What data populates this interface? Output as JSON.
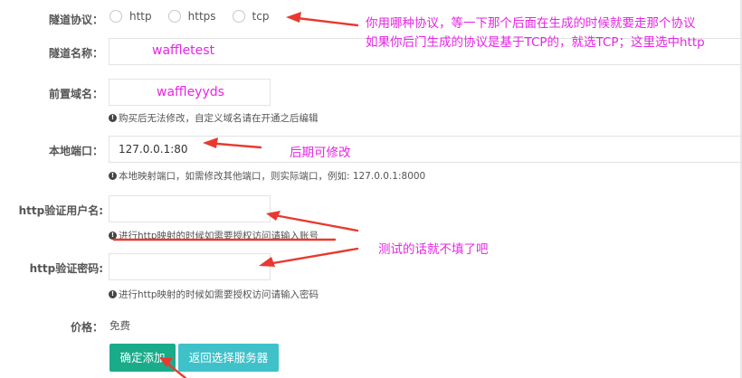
{
  "form": {
    "protocol": {
      "label": "隧道协议：",
      "options": [
        "http",
        "https",
        "tcp"
      ]
    },
    "tunnel_name": {
      "label": "隧道名称："
    },
    "prefix_domain": {
      "label": "前置域名：",
      "hint": "购买后无法修改，自定义域名请在开通之后编辑"
    },
    "local_port": {
      "label": "本地端口：",
      "value": "127.0.0.1:80",
      "hint": "本地映射端口，如需修改其他端口，则实际端口，例如:  127.0.0.1:8000"
    },
    "http_user": {
      "label": "http验证用户名:",
      "hint": "进行http映射的时候如需要授权访问请输入账号"
    },
    "http_pass": {
      "label": "http验证密码:",
      "hint": "进行http映射的时候如需要授权访问请输入密码"
    },
    "price": {
      "label": "价格：",
      "value": "免费"
    }
  },
  "buttons": {
    "confirm_add": "确定添加",
    "back_to_server": "返回选择服务器"
  },
  "annotations": {
    "protocol_note_line1": "你用哪种协议，等一下那个后面在生成的时候就要走那个协议",
    "protocol_note_line2": "如果你后门生成的协议是基于TCP的，就选TCP；这里选中http",
    "tunnel_name_text": "waffletest",
    "prefix_domain_text": "waffleyyds",
    "port_note": "后期可修改",
    "auth_note": "测试的话就不填了吧"
  },
  "colors": {
    "annotation_text": "#e526e5",
    "arrow_red": "#e8392f",
    "primary_button": "#1aab8b",
    "secondary_button": "#3fc1c9"
  },
  "icons": {
    "hint": "info-circle-icon"
  }
}
